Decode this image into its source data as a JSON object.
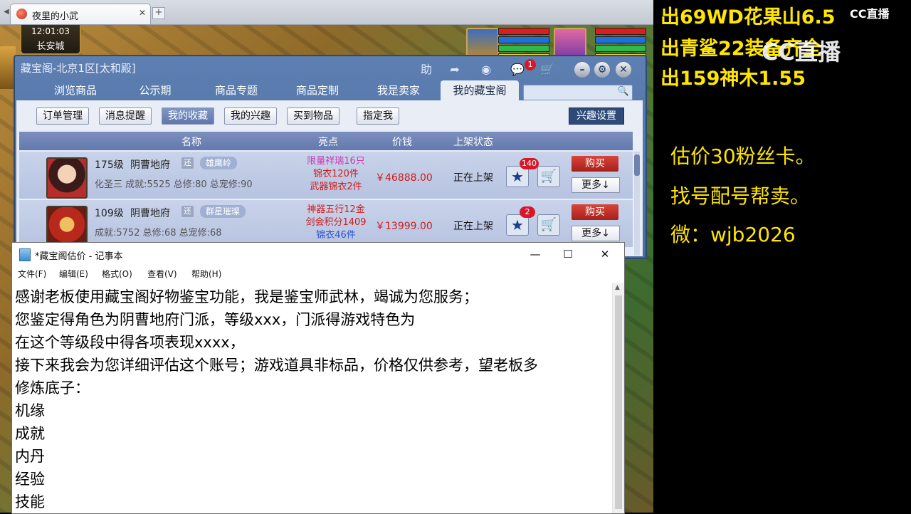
{
  "browser": {
    "tab_title": "夜里的小武",
    "tab_close": "✕",
    "new_tab": "+"
  },
  "game": {
    "time": "12:01:03",
    "location": "长安城"
  },
  "cbg": {
    "title": "藏宝阁-北京1区[太和殿]",
    "icons": [
      "help-icon",
      "share-icon",
      "record-icon",
      "chat-icon",
      "cart-icon",
      "minimize-icon",
      "settings-icon",
      "close-icon"
    ],
    "help_label": "助",
    "chat_badge": "1",
    "tabs": [
      "浏览商品",
      "公示期",
      "商品专题",
      "商品定制",
      "我是卖家",
      "我的藏宝阁"
    ],
    "active_tab": "我的藏宝阁",
    "subtabs": [
      "订单管理",
      "消息提醒",
      "我的收藏",
      "我的兴趣",
      "买到物品",
      "指定我"
    ],
    "active_subtab": "我的收藏",
    "interest_settings": "兴趣设置",
    "columns": [
      "名称",
      "亮点",
      "价钱",
      "上架状态"
    ],
    "rows": [
      {
        "level": "175级",
        "school": "阴曹地府",
        "tag1": "还",
        "tag2": "雄鹰岭",
        "stats": "化圣三  成就:5525 总修:80 总宠修:90",
        "highlights": [
          "限量祥瑞16只",
          "锦衣120件",
          "武器锦衣2件"
        ],
        "price": "￥46888.00",
        "status": "正在上架",
        "fav_count": "140",
        "buy": "购买",
        "more": "更多↓"
      },
      {
        "level": "109级",
        "school": "阴曹地府",
        "tag1": "还",
        "tag2": "群星璀璨",
        "stats": "成就:5752 总修:68 总宠修:68",
        "highlights": [
          "神器五行12金",
          "剑会积分1409",
          "锦衣46件"
        ],
        "price": "￥13999.00",
        "status": "正在上架",
        "fav_count": "2",
        "buy": "购买",
        "more": "更多↓"
      }
    ]
  },
  "notepad": {
    "title": "*藏宝阁估价 - 记事本",
    "controls": {
      "minimize": "—",
      "maximize": "☐",
      "close": "✕"
    },
    "menu": [
      "文件(F)",
      "编辑(E)",
      "格式(O)",
      "查看(V)",
      "帮助(H)"
    ],
    "lines": [
      "感谢老板使用藏宝阁好物鉴宝功能，我是鉴宝师武林，竭诚为您服务；",
      "您鉴定得角色为阴曹地府门派，等级xxx，门派得游戏特色为",
      "在这个等级段中得各项表现xxxx，",
      "接下来我会为您详细评估这个账号；游戏道具非标品，价格仅供参考，望老板多",
      "修炼底子：",
      "机缘",
      "成就",
      "内丹",
      "经验",
      "技能"
    ]
  },
  "overlay": {
    "ads": [
      "出69WD花果山6.5",
      "出青鲨22装备齐全",
      "出159神木1.55"
    ],
    "logo_small": "CC直播",
    "logo_big": "CC直播",
    "notes": [
      "估价30粉丝卡。",
      "找号配号帮卖。",
      "微：wjb2026"
    ]
  },
  "colors": {
    "overlay_text": "#ffe600",
    "price_red": "#d01c1c",
    "cbg_blue": "#4b6b9c"
  }
}
